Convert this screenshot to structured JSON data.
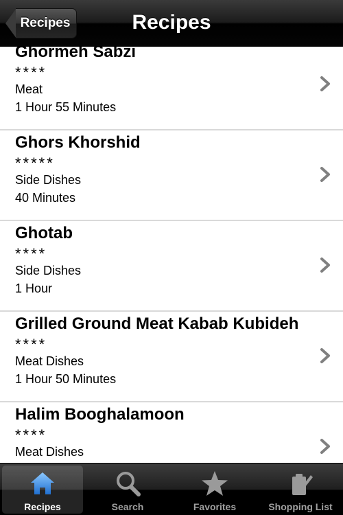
{
  "navbar": {
    "back_label": "Recipes",
    "title": "Recipes"
  },
  "recipes": [
    {
      "name": "Ghormeh Sabzi",
      "stars": "****",
      "category": "Meat",
      "time": "1 Hour 55 Minutes"
    },
    {
      "name": "Ghors Khorshid",
      "stars": "*****",
      "category": "Side Dishes",
      "time": "40 Minutes"
    },
    {
      "name": "Ghotab",
      "stars": "****",
      "category": "Side Dishes",
      "time": "1 Hour"
    },
    {
      "name": "Grilled Ground Meat Kabab Kubideh",
      "stars": "****",
      "category": "Meat Dishes",
      "time": "1 Hour 50 Minutes"
    },
    {
      "name": "Halim Booghalamoon",
      "stars": "****",
      "category": "Meat Dishes",
      "time": ""
    }
  ],
  "tabbar": {
    "tabs": [
      {
        "label": "Recipes",
        "icon": "house-icon",
        "active": true
      },
      {
        "label": "Search",
        "icon": "magnifier-icon",
        "active": false
      },
      {
        "label": "Favorites",
        "icon": "star-icon",
        "active": false
      },
      {
        "label": "Shopping List",
        "icon": "shopping-list-icon",
        "active": false
      }
    ]
  },
  "colors": {
    "bar_dark": "#000000",
    "tab_active_icon": "#3a8fe0",
    "tab_inactive_icon": "#9a9a9a",
    "chevron": "#808080",
    "separator": "#d9d9d9"
  }
}
